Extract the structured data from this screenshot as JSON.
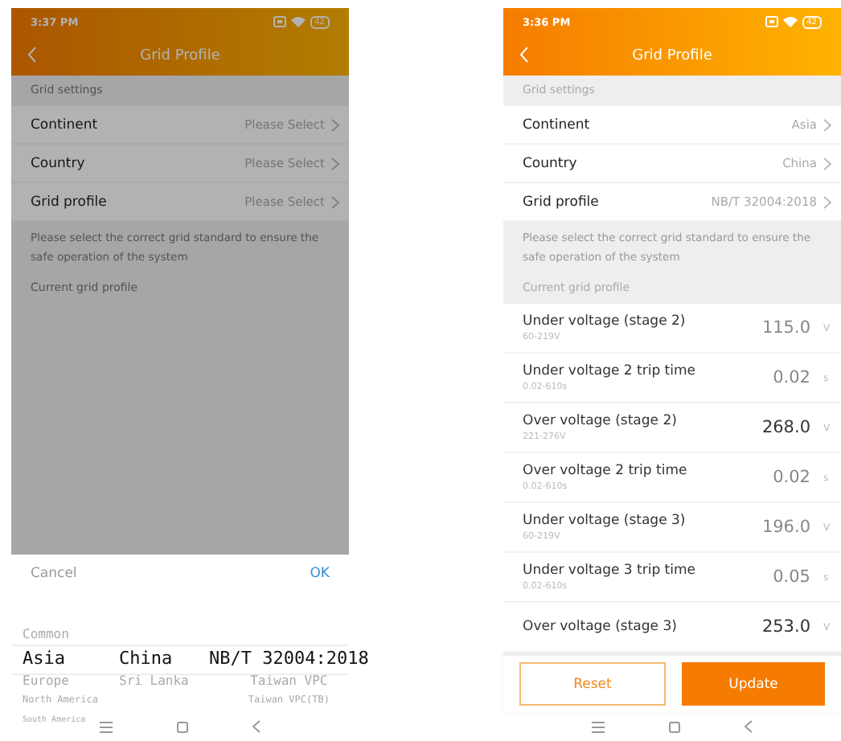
{
  "screens": [
    {
      "dimmed": true,
      "status_bar": {
        "time": "3:37 PM",
        "battery": "42"
      },
      "header": {
        "title": "Grid Profile"
      },
      "settings": {
        "heading": "Grid settings",
        "rows": [
          {
            "label": "Continent",
            "placeholder": "Please Select"
          },
          {
            "label": "Country",
            "placeholder": "Please Select"
          },
          {
            "label": "Grid profile",
            "placeholder": "Please Select"
          }
        ],
        "note": "Please select the correct grid standard to ensure the safe operation of the system",
        "profile_heading": "Current grid profile"
      },
      "picker": {
        "cancel": "Cancel",
        "ok": "OK",
        "columns": [
          {
            "items": [
              {
                "label": "Common",
                "selected": false
              },
              {
                "label": "Asia",
                "selected": true
              },
              {
                "label": "Europe",
                "selected": false
              },
              {
                "label": "North America",
                "selected": false
              },
              {
                "label": "South America",
                "selected": false
              }
            ]
          },
          {
            "items": [
              {
                "label": "China",
                "selected": true
              },
              {
                "label": "Sri Lanka",
                "selected": false
              }
            ]
          },
          {
            "items": [
              {
                "label": "NB/T 32004:2018",
                "selected": true
              },
              {
                "label": "Taiwan VPC",
                "selected": false
              },
              {
                "label": "Taiwan VPC(TB)",
                "selected": false
              }
            ]
          }
        ]
      }
    },
    {
      "dimmed": false,
      "status_bar": {
        "time": "3:36 PM",
        "battery": "42"
      },
      "header": {
        "title": "Grid Profile"
      },
      "settings": {
        "heading": "Grid settings",
        "rows": [
          {
            "label": "Continent",
            "value": "Asia"
          },
          {
            "label": "Country",
            "value": "China"
          },
          {
            "label": "Grid profile",
            "value": "NB/T 32004:2018"
          }
        ],
        "note": "Please select the correct grid standard to ensure the safe operation of the system",
        "profile_heading": "Current grid profile"
      },
      "parameters": [
        {
          "label": "Under voltage (stage 2)",
          "range": "60-219V",
          "value": "115.0",
          "unit": "V",
          "modified": false
        },
        {
          "label": "Under voltage 2 trip time",
          "range": "0.02-610s",
          "value": "0.02",
          "unit": "s",
          "modified": false
        },
        {
          "label": "Over voltage (stage 2)",
          "range": "221-276V",
          "value": "268.0",
          "unit": "V",
          "modified": true
        },
        {
          "label": "Over voltage 2 trip time",
          "range": "0.02-610s",
          "value": "0.02",
          "unit": "s",
          "modified": false
        },
        {
          "label": "Under voltage (stage 3)",
          "range": "60-219V",
          "value": "196.0",
          "unit": "V",
          "modified": false
        },
        {
          "label": "Under voltage 3 trip time",
          "range": "0.02-610s",
          "value": "0.05",
          "unit": "s",
          "modified": false
        },
        {
          "label": "Over voltage (stage 3)",
          "value": "253.0",
          "unit": "V",
          "modified": true
        }
      ],
      "buttons": [
        {
          "label": "Reset",
          "kind": "outline"
        },
        {
          "label": "Update",
          "kind": "filled"
        }
      ]
    }
  ]
}
